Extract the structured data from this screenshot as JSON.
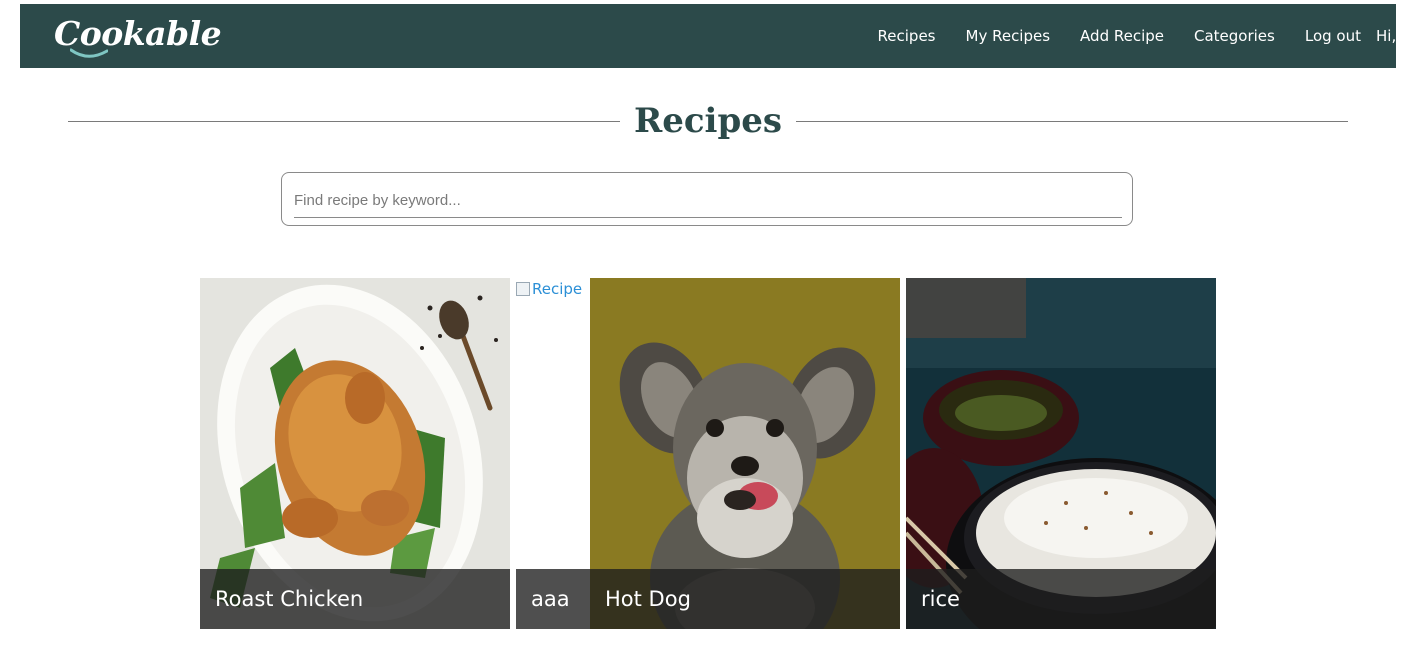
{
  "brand": {
    "name": "Cookable",
    "bar_color": "#2c4a4a",
    "accent_color": "#7fc6c3"
  },
  "nav": {
    "items": [
      "Recipes",
      "My Recipes",
      "Add Recipe",
      "Categories",
      "Log out"
    ],
    "greeting": "Hi,"
  },
  "page": {
    "title": "Recipes"
  },
  "search": {
    "placeholder": "Find recipe by keyword...",
    "value": ""
  },
  "recipes": [
    {
      "name": "Roast Chicken",
      "image": "roast-chicken-photo"
    },
    {
      "name": "aaa",
      "image": "broken-image",
      "alt": "Recipe"
    },
    {
      "name": "Hot Dog",
      "image": "schnauzer-dog-photo"
    },
    {
      "name": "rice",
      "image": "rice-bowl-photo"
    }
  ]
}
